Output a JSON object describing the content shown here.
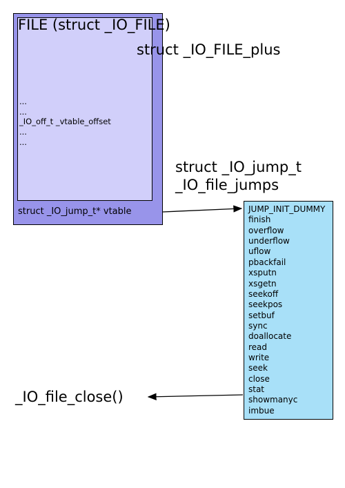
{
  "file_struct": {
    "title": "FILE (struct _IO_FILE)",
    "fields": [
      "...",
      "...",
      "_IO_off_t _vtable_offset",
      "...",
      "..."
    ]
  },
  "file_plus": {
    "title": "struct _IO_FILE_plus",
    "vtable_field": "struct _IO_jump_t* vtable"
  },
  "jump_table": {
    "type_label": "struct _IO_jump_t",
    "instance_label": "_IO_file_jumps",
    "entries": [
      "JUMP_INIT_DUMMY",
      "finish",
      "overflow",
      "underflow",
      "uflow",
      "pbackfail",
      "xsputn",
      "xsgetn",
      "seekoff",
      "seekpos",
      "setbuf",
      "sync",
      "doallocate",
      "read",
      "write",
      "seek",
      "close",
      "stat",
      "showmanyc",
      "imbue"
    ]
  },
  "close_fn": "_IO_file_close()"
}
